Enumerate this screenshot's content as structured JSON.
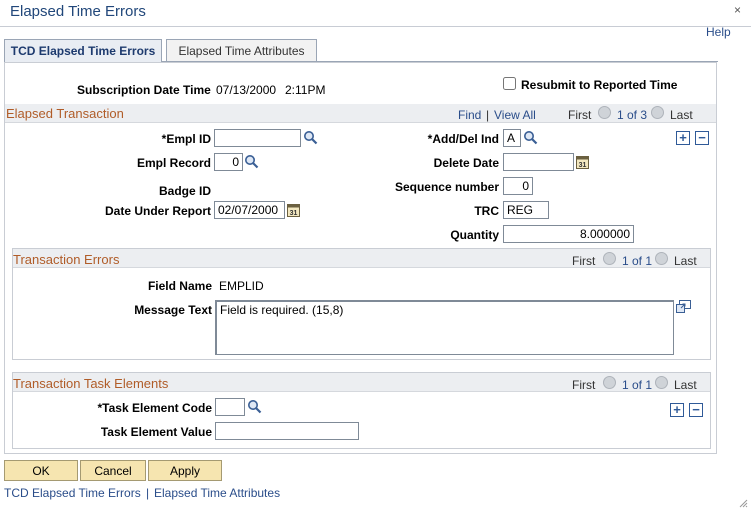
{
  "page": {
    "title": "Elapsed Time Errors",
    "close_glyph": "×",
    "help_label": "Help"
  },
  "tabs": [
    {
      "label": "TCD Elapsed Time Errors",
      "active": true
    },
    {
      "label": "Elapsed Time Attributes",
      "active": false
    }
  ],
  "header": {
    "subscription_label": "Subscription Date Time",
    "subscription_date": "07/13/2000",
    "subscription_time": "2:11PM",
    "resubmit_label": "Resubmit to Reported Time",
    "resubmit_checked": false
  },
  "elapsed": {
    "title": "Elapsed Transaction",
    "find": "Find",
    "sep": "|",
    "view_all": "View All",
    "first": "First",
    "counter": "1 of 3",
    "last": "Last",
    "empl_id_label": "*Empl ID",
    "empl_id_value": "",
    "empl_record_label": "Empl Record",
    "empl_record_value": "0",
    "badge_id_label": "Badge ID",
    "date_label": "Date Under Report",
    "date_value": "02/07/2000",
    "adddel_label": "*Add/Del Ind",
    "adddel_value": "A",
    "delete_date_label": "Delete Date",
    "delete_date_value": "",
    "seq_label": "Sequence number",
    "seq_value": "0",
    "trc_label": "TRC",
    "trc_value": "REG",
    "qty_label": "Quantity",
    "qty_value": "8.000000"
  },
  "errors": {
    "title": "Transaction Errors",
    "first": "First",
    "counter": "1 of 1",
    "last": "Last",
    "field_label": "Field Name",
    "field_value": "EMPLID",
    "message_label": "Message Text",
    "message_value": "Field is required. (15,8)"
  },
  "tasks": {
    "title": "Transaction Task Elements",
    "first": "First",
    "counter": "1 of 1",
    "last": "Last",
    "code_label": "*Task Element Code",
    "code_value": "",
    "value_label": "Task Element Value",
    "value_value": ""
  },
  "buttons": {
    "ok": "OK",
    "cancel": "Cancel",
    "apply": "Apply"
  },
  "footer": {
    "link1": "TCD Elapsed Time Errors",
    "sep": "|",
    "link2": "Elapsed Time Attributes"
  },
  "colors": {
    "section_title": "#b05c28",
    "link": "#2a4d8a",
    "button": "#f6e5b0"
  }
}
